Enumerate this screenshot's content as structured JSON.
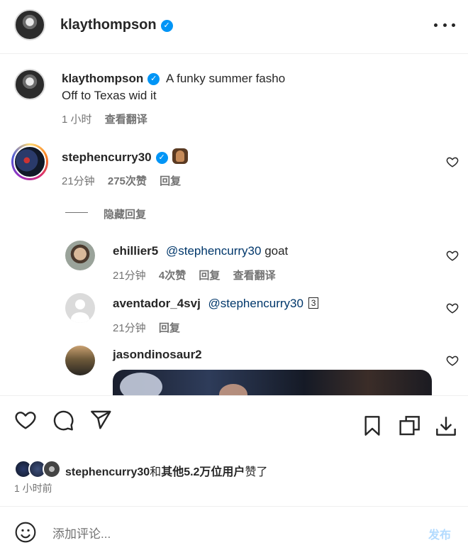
{
  "header": {
    "username": "klaythompson",
    "more_icon": "more-horizontal-icon"
  },
  "caption": {
    "username": "klaythompson",
    "text_line1": "A funky summer fasho",
    "text_line2": "Off to Texas wid it",
    "time": "1 小时",
    "translate": "查看翻译"
  },
  "comments": [
    {
      "username": "stephencurry30",
      "verified": true,
      "emoji": "praying-hands-emoji",
      "time": "21分钟",
      "likes": "275次赞",
      "reply": "回复"
    }
  ],
  "hide_replies": "隐藏回复",
  "replies": [
    {
      "username": "ehillier5",
      "mention": "@stephencurry30",
      "text": "goat",
      "time": "21分钟",
      "likes": "4次赞",
      "reply": "回复",
      "translate": "查看翻译"
    },
    {
      "username": "aventador_4svj",
      "mention": "@stephencurry30",
      "text": "3",
      "time": "21分钟",
      "reply": "回复"
    },
    {
      "username": "jasondinosaur2"
    }
  ],
  "actions": {
    "like": "heart-icon",
    "comment": "comment-icon",
    "share": "send-icon",
    "save": "bookmark-icon",
    "collections": "copy-icon",
    "download": "download-icon"
  },
  "likes_summary": {
    "username": "stephencurry30",
    "conj": "和",
    "others": "其他5.2万位用户",
    "suffix": "赞了"
  },
  "post_time": "1 小时前",
  "comment_box": {
    "placeholder": "添加评论...",
    "post_label": "发布"
  },
  "colors": {
    "verified": "#0095f6",
    "mention": "#00376b",
    "muted": "#737373",
    "post_button": "#b3dbff"
  }
}
